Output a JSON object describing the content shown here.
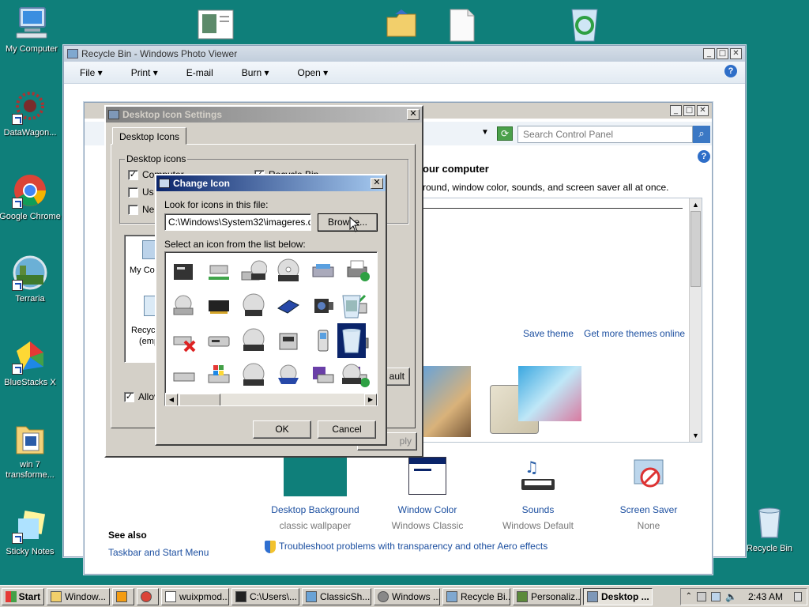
{
  "desktop": {
    "icons": [
      {
        "label": "My Computer"
      },
      {
        "label": "DataWagon..."
      },
      {
        "label": "Google Chrome"
      },
      {
        "label": "Terraria"
      },
      {
        "label": "BlueStacks X"
      },
      {
        "label": "win 7 transforme..."
      },
      {
        "label": "Sticky Notes"
      },
      {
        "label": "Recycle Bin"
      }
    ]
  },
  "photo_viewer": {
    "title": "Recycle Bin - Windows Photo Viewer",
    "menu": [
      "File",
      "Print",
      "E-mail",
      "Burn",
      "Open"
    ]
  },
  "control_panel": {
    "search_placeholder": "Search Control Panel",
    "heading": "our computer",
    "description": "round, window color, sounds, and screen saver all at once.",
    "save_theme": "Save theme",
    "more_themes": "Get more themes online",
    "items": [
      {
        "label": "Desktop Background",
        "sub": "classic wallpaper"
      },
      {
        "label": "Window Color",
        "sub": "Windows Classic"
      },
      {
        "label": "Sounds",
        "sub": "Windows Default"
      },
      {
        "label": "Screen Saver",
        "sub": "None"
      }
    ],
    "see_also_title": "See also",
    "see_also_link": "Taskbar and Start Menu",
    "troubleshoot": "Troubleshoot problems with transparency and other Aero effects"
  },
  "desktop_icon_settings": {
    "title": "Desktop Icon Settings",
    "tab": "Desktop Icons",
    "group": "Desktop icons",
    "cb_computer": "Computer",
    "cb_user": "Us",
    "cb_network": "Ne",
    "cb_recycle": "Recycle Bin",
    "preview_my_computer": "My Co",
    "preview_recycle": "Recyc",
    "preview_recycle2": "(emp",
    "allow": "Allov",
    "default_btn": "ault",
    "apply_btn": "ply"
  },
  "change_icon": {
    "title": "Change Icon",
    "look_label": "Look for icons in this file:",
    "file_path": "C:\\Windows\\System32\\imageres.dll",
    "browse": "Browse...",
    "select_label": "Select an icon from the list below:",
    "ok": "OK",
    "cancel": "Cancel"
  },
  "taskbar": {
    "start": "Start",
    "buttons": [
      "Window...",
      "",
      "",
      "wuixpmod...",
      "C:\\Users\\...",
      "ClassicSh...",
      "Windows ...",
      "Recycle Bi...",
      "Personaliz...",
      "Desktop ..."
    ],
    "clock": "2:43 AM"
  },
  "colors": {
    "desktop": "#0f7f7a",
    "classic_face": "#d4d0c8",
    "title_active": "#0a246a",
    "link": "#1c4fa0"
  }
}
